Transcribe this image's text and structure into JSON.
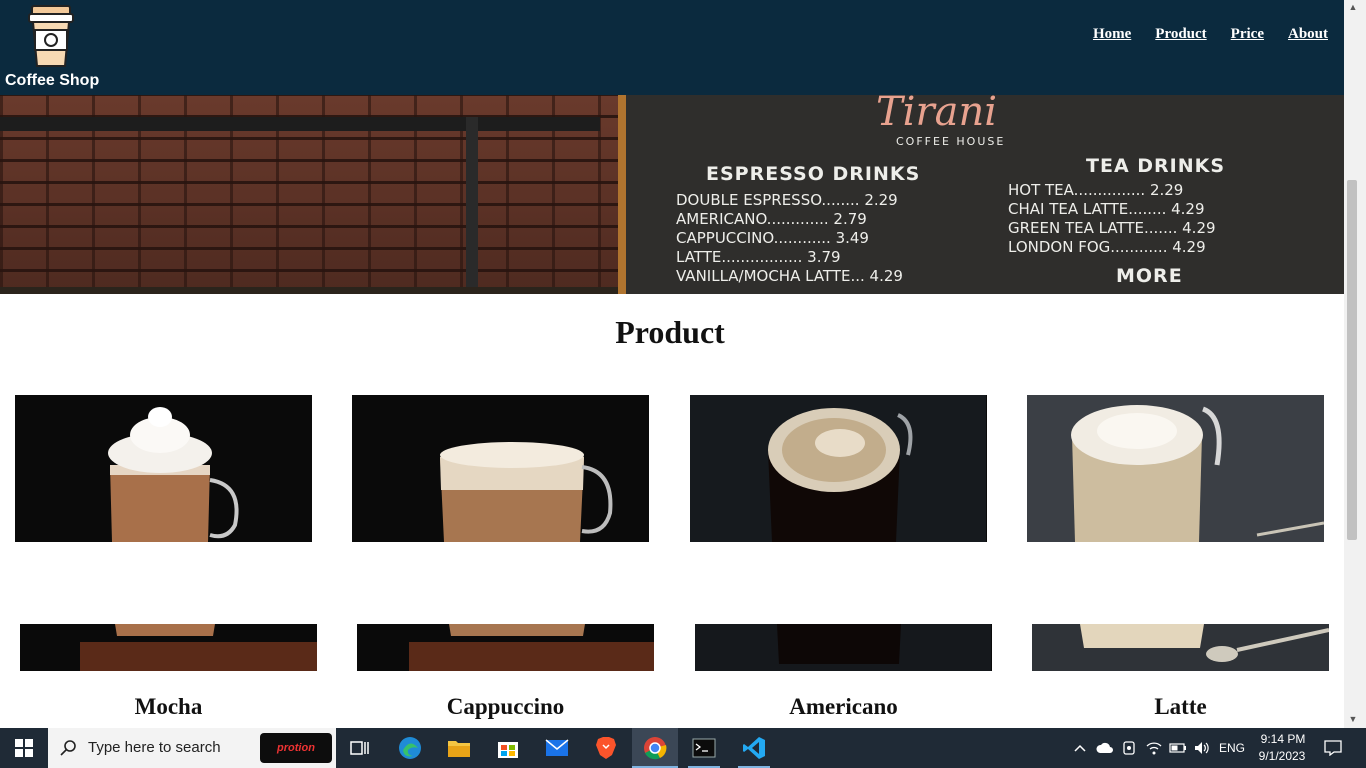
{
  "header": {
    "brand": "Coffee Shop",
    "nav": [
      "Home",
      "Product",
      "Price",
      "About"
    ]
  },
  "hero": {
    "board_title": "Tirani",
    "board_subtitle": "COFFEE HOUSE",
    "espresso_heading": "ESPRESSO DRINKS",
    "espresso_items": [
      "DOUBLE ESPRESSO........ 2.29",
      "AMERICANO............. 2.79",
      "CAPPUCCINO............ 3.49",
      "LATTE................. 3.79",
      "VANILLA/MOCHA LATTE... 4.29"
    ],
    "tea_heading": "TEA DRINKS",
    "tea_items": [
      "HOT TEA............... 2.29",
      "CHAI TEA LATTE........ 4.29",
      "GREEN TEA LATTE....... 4.29",
      "LONDON FOG............ 4.29"
    ],
    "more_heading": "MORE"
  },
  "products": {
    "title": "Product",
    "items": [
      {
        "name": "Mocha"
      },
      {
        "name": "Cappuccino"
      },
      {
        "name": "Americano"
      },
      {
        "name": "Latte"
      }
    ]
  },
  "taskbar": {
    "search_placeholder": "Type here to search",
    "promo": "protion",
    "language": "ENG",
    "time": "9:14 PM",
    "date": "9/1/2023"
  },
  "colors": {
    "header_bg": "#0b2a3e",
    "taskbar_bg": "#1f2a36"
  }
}
